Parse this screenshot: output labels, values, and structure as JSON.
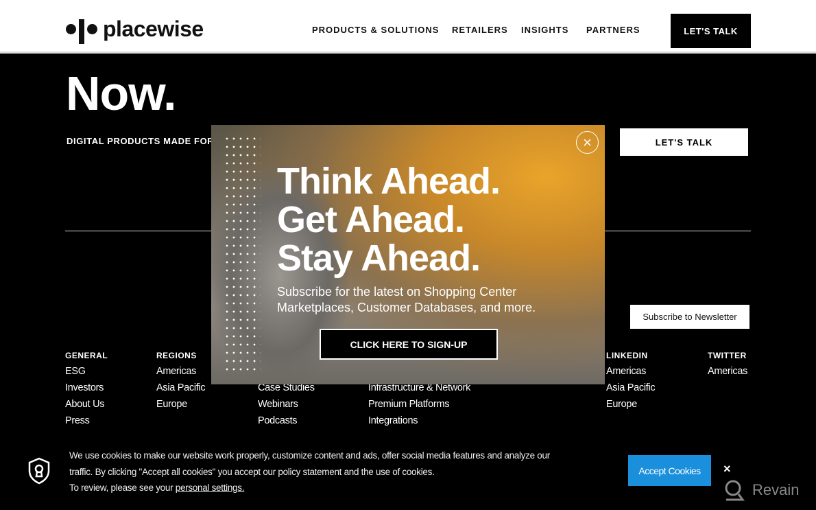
{
  "header": {
    "logo": "placewise",
    "nav": [
      "PRODUCTS & SOLUTIONS",
      "RETAILERS",
      "INSIGHTS",
      "PARTNERS"
    ],
    "cta": "LET'S TALK"
  },
  "hero": {
    "title_cut": "Be Ready. Now.",
    "title": "Now.",
    "subtitle": "DIGITAL PRODUCTS MADE FOR",
    "cta": "LET'S TALK"
  },
  "newsletter": "Subscribe to Newsletter",
  "footer": {
    "columns": [
      {
        "heading": "GENERAL",
        "items": [
          "ESG",
          "Investors",
          "About Us",
          "Press"
        ]
      },
      {
        "heading": "REGIONS",
        "items": [
          "Americas",
          "Asia Pacific",
          "Europe"
        ]
      },
      {
        "heading": "",
        "items": [
          "",
          "Case Studies",
          "Webinars",
          "Podcasts"
        ]
      },
      {
        "heading": "",
        "items": [
          "",
          "Infrastructure & Network",
          "Premium Platforms",
          "Integrations"
        ]
      },
      {
        "heading": "LINKEDIN",
        "items": [
          "Americas",
          "Asia Pacific",
          "Europe"
        ]
      },
      {
        "heading": "TWITTER",
        "items": [
          "Americas"
        ]
      }
    ]
  },
  "popup": {
    "headline": [
      "Think Ahead.",
      "Get Ahead.",
      "Stay Ahead."
    ],
    "body": [
      "Subscribe for the latest on Shopping Center",
      "Marketplaces, Customer Databases, and more."
    ],
    "cta": "CLICK HERE TO SIGN-UP",
    "close": "×"
  },
  "cookie": {
    "line1": "We use cookies to make our website work properly, customize content and ads, offer social media features and analyze our",
    "line2": "traffic. By clicking \"Accept all cookies\" you accept our policy statement and the use of cookies.",
    "line3": "To review, please see your ",
    "link": "personal settings.",
    "accept": "Accept Cookies",
    "close": "×",
    "accent": "#1a8fdb"
  },
  "watermark": "Revain"
}
